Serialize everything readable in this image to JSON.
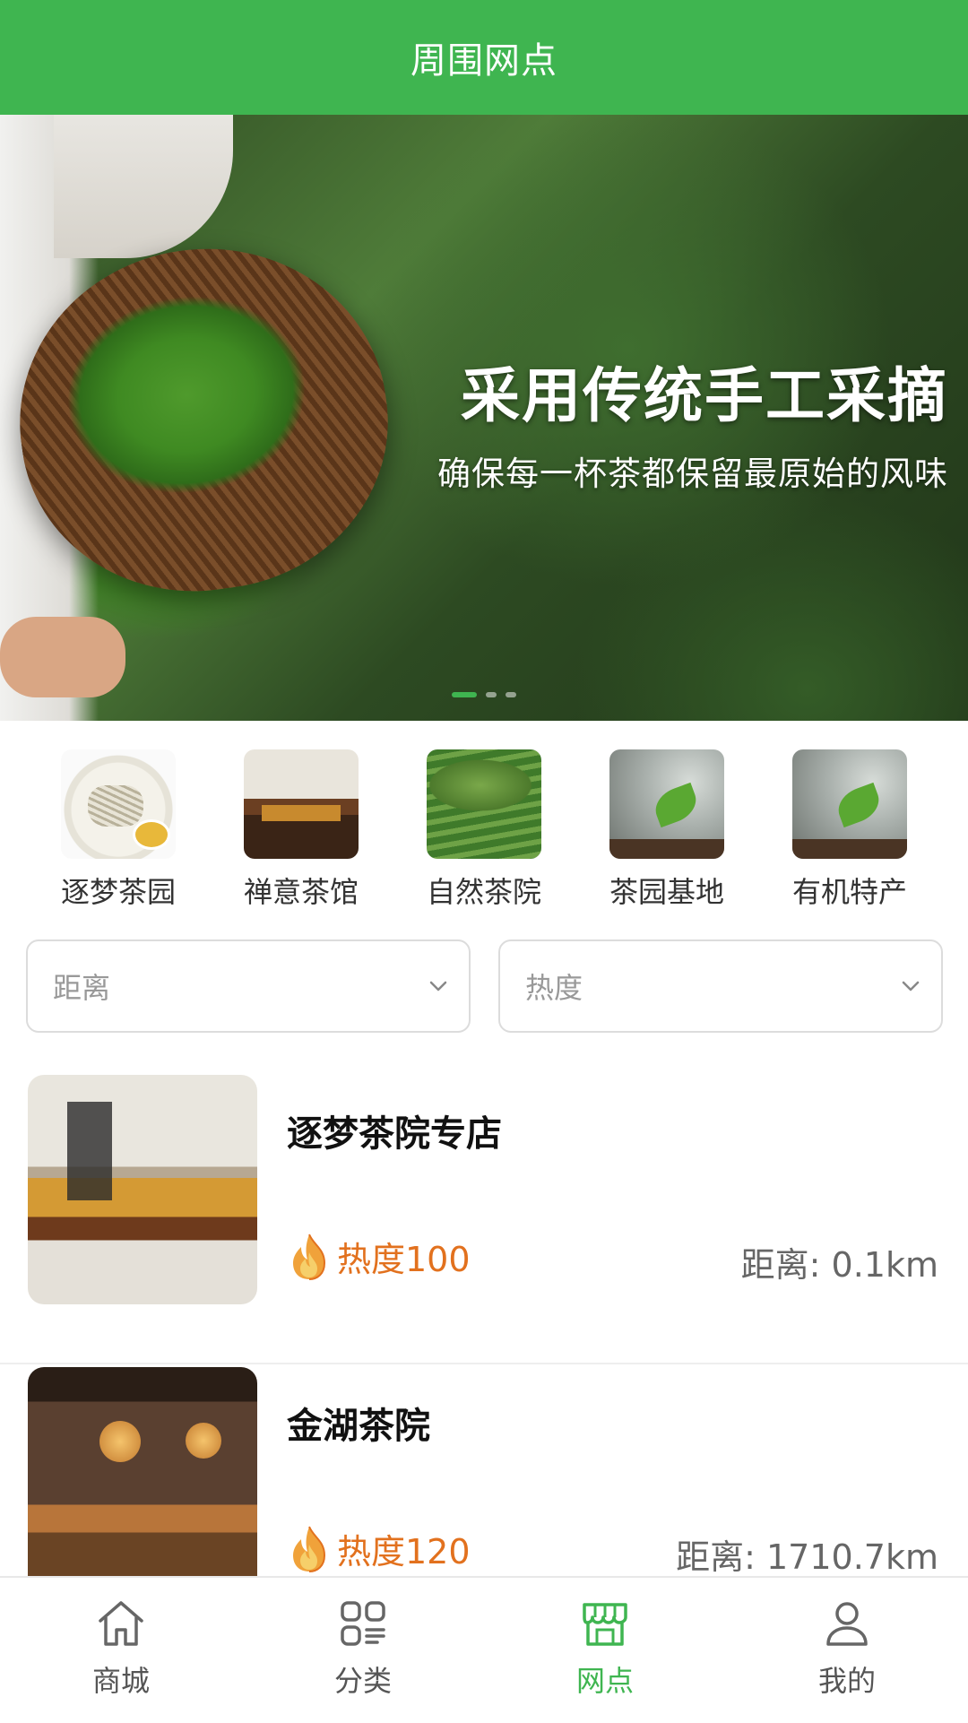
{
  "header": {
    "title": "周围网点"
  },
  "banner": {
    "headline": "采用传统手工采摘",
    "subline": "确保每一杯茶都保留最原始的风味",
    "active_dot": 0
  },
  "categories": [
    {
      "label": "逐梦茶园"
    },
    {
      "label": "禅意茶馆"
    },
    {
      "label": "自然茶院"
    },
    {
      "label": "茶园基地"
    },
    {
      "label": "有机特产"
    }
  ],
  "filters": {
    "distance_placeholder": "距离",
    "heat_placeholder": "热度"
  },
  "stores": [
    {
      "name": "逐梦茶院专店",
      "heat": "热度100",
      "distance": "距离: 0.1km"
    },
    {
      "name": "金湖茶院",
      "heat": "热度120",
      "distance": "距离: 1710.7km"
    }
  ],
  "tabbar": [
    {
      "label": "商城",
      "icon": "home-icon"
    },
    {
      "label": "分类",
      "icon": "category-icon"
    },
    {
      "label": "网点",
      "icon": "store-icon",
      "active": true
    },
    {
      "label": "我的",
      "icon": "user-icon"
    }
  ],
  "colors": {
    "brand": "#3fb550",
    "heat": "#e2711e"
  }
}
